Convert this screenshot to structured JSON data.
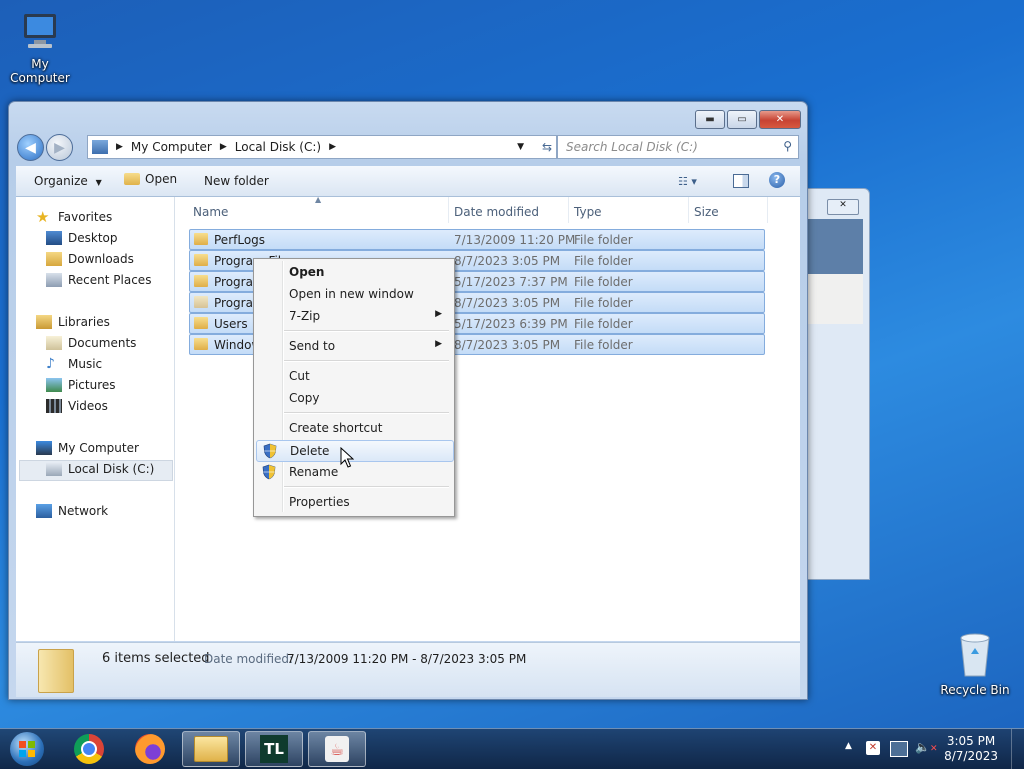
{
  "desktop": {
    "my_computer_label": "My Computer",
    "recycle_bin_label": "Recycle Bin"
  },
  "window": {
    "caption": {
      "minimize": "▬",
      "maximize": "▭",
      "close": "✕"
    },
    "breadcrumb": [
      "My Computer",
      "Local Disk (C:)"
    ],
    "search_placeholder": "Search Local Disk (C:)",
    "toolbar": {
      "organize": "Organize",
      "open": "Open",
      "new_folder": "New folder"
    },
    "nav": {
      "favorites": "Favorites",
      "desktop": "Desktop",
      "downloads": "Downloads",
      "recent_places": "Recent Places",
      "libraries": "Libraries",
      "documents": "Documents",
      "music": "Music",
      "pictures": "Pictures",
      "videos": "Videos",
      "my_computer": "My Computer",
      "local_disk": "Local Disk (C:)",
      "network": "Network"
    },
    "columns": {
      "name": "Name",
      "date": "Date modified",
      "type": "Type",
      "size": "Size"
    },
    "rows": [
      {
        "name": "PerfLogs",
        "date": "7/13/2009 11:20 PM",
        "type": "File folder"
      },
      {
        "name": "Program Files",
        "date": "8/7/2023 3:05 PM",
        "type": "File folder"
      },
      {
        "name": "Program Files (x86)",
        "date": "5/17/2023 7:37 PM",
        "type": "File folder"
      },
      {
        "name": "ProgramData",
        "date": "8/7/2023 3:05 PM",
        "type": "File folder"
      },
      {
        "name": "Users",
        "date": "5/17/2023 6:39 PM",
        "type": "File folder"
      },
      {
        "name": "Windows",
        "date": "8/7/2023 3:05 PM",
        "type": "File folder"
      }
    ],
    "visible_names": [
      "PerfLogs",
      "Program Files",
      "Program",
      "Program",
      "Users",
      "Window"
    ],
    "status": {
      "selected": "6 items selected",
      "date_label": "Date modified:",
      "date_range": "7/13/2009 11:20 PM - 8/7/2023 3:05 PM"
    }
  },
  "context_menu": {
    "open": "Open",
    "open_new_window": "Open in new window",
    "seven_zip": "7-Zip",
    "send_to": "Send to",
    "cut": "Cut",
    "copy": "Copy",
    "create_shortcut": "Create shortcut",
    "delete": "Delete",
    "rename": "Rename",
    "properties": "Properties",
    "highlighted": "Delete"
  },
  "taskbar": {
    "clock_time": "3:05 PM",
    "clock_date": "8/7/2023",
    "tl_label": "TL"
  },
  "colors": {
    "accent": "#3399ff",
    "selection": "#cce4f7"
  }
}
